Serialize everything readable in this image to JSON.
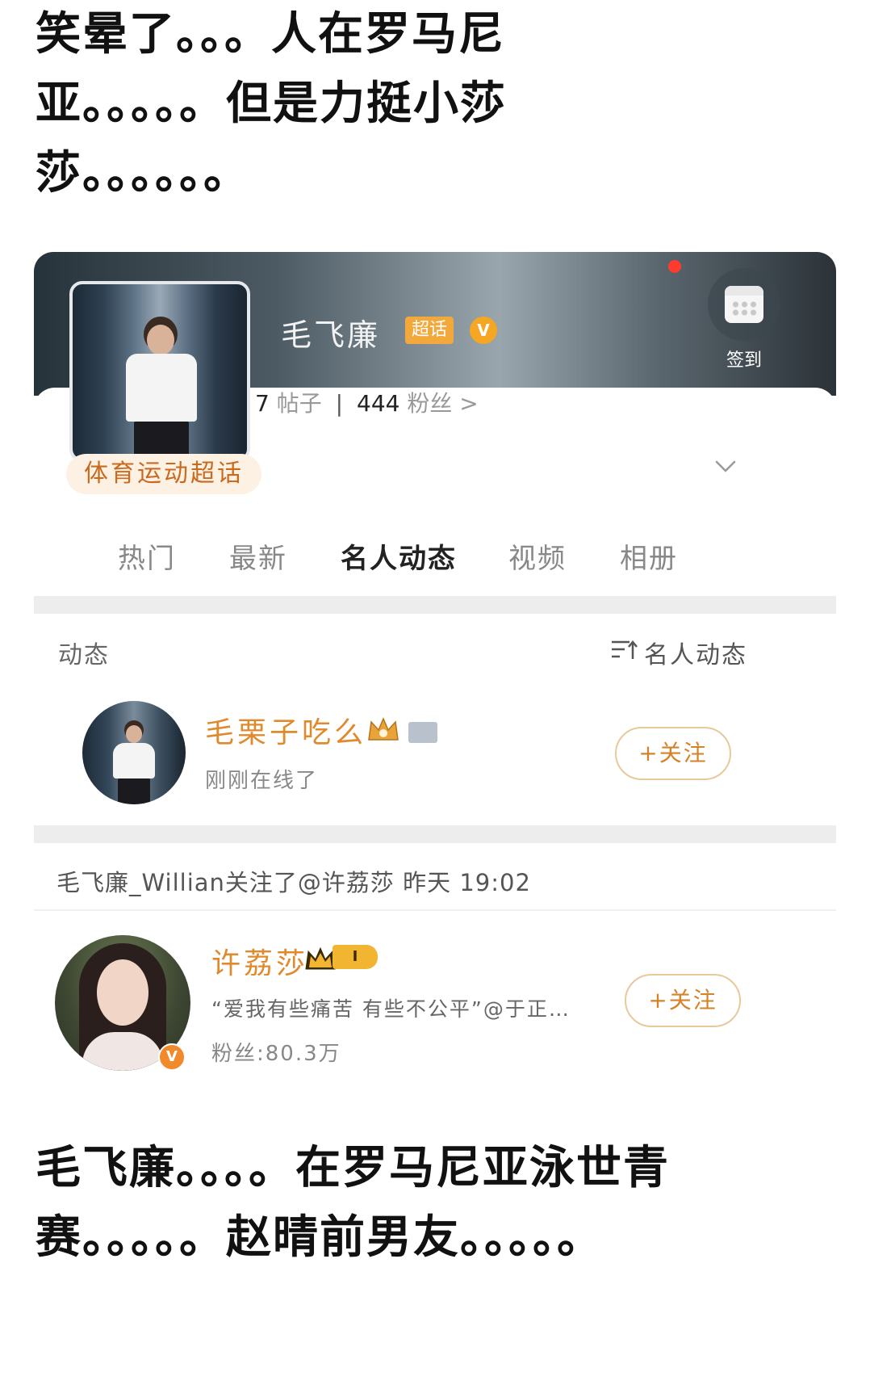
{
  "caption_top": "笑晕了。。。人在罗马尼亚。。。。。但是力挺小莎莎。。。。。。",
  "caption_bottom": "毛飞廉。。。。在罗马尼亚泳世青赛。。。。。赵晴前男友。。。。。",
  "topic": {
    "name": "毛飞廉",
    "super_tag": "超话",
    "verified_glyph": "V",
    "posts_count": "7",
    "posts_label": "帖子",
    "fans_count": "444",
    "fans_label": "粉丝",
    "fans_arrow": ">",
    "category": "体育运动超话",
    "checkin_label": "签到",
    "accent_color": "#f0782b"
  },
  "tabs": [
    {
      "label": "热门",
      "active": false
    },
    {
      "label": "最新",
      "active": false
    },
    {
      "label": "名人动态",
      "active": true
    },
    {
      "label": "视频",
      "active": false
    },
    {
      "label": "相册",
      "active": false
    }
  ],
  "feed": {
    "section_label": "动态",
    "sort_label": "名人动态",
    "user1": {
      "name": "毛栗子吃么",
      "status": "刚刚在线了",
      "follow_label": "+关注"
    },
    "follow_event": "毛飞廉_Willian关注了@许荔莎 昨天 19:02",
    "user2": {
      "name": "许荔莎",
      "level": "I",
      "bio": "“爱我有些痛苦 有些不公平”@于正…",
      "fans": "粉丝:80.3万",
      "follow_label": "+关注",
      "verified_glyph": "V"
    }
  },
  "icons": {
    "crown": "crown-icon",
    "calendar": "calendar-icon",
    "chevron": "chevron-down-icon",
    "sort": "sort-icon"
  }
}
